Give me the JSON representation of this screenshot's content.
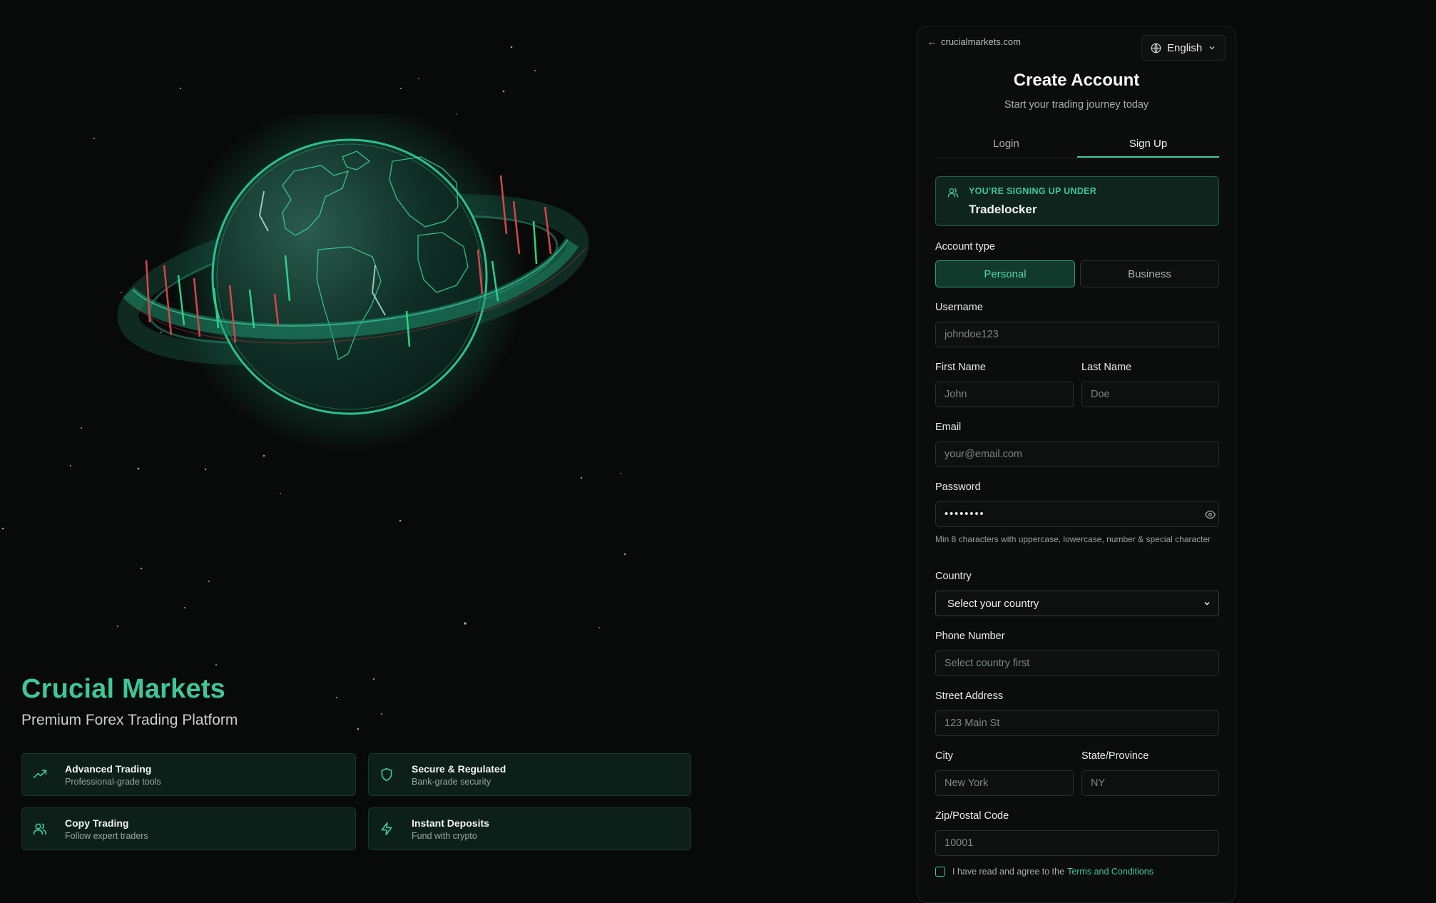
{
  "brand": {
    "title": "Crucial Markets",
    "subtitle": "Premium Forex Trading Platform"
  },
  "features": [
    {
      "icon": "trending-up-icon",
      "title": "Advanced Trading",
      "subtitle": "Professional-grade tools"
    },
    {
      "icon": "shield-icon",
      "title": "Secure & Regulated",
      "subtitle": "Bank-grade security"
    },
    {
      "icon": "users-icon",
      "title": "Copy Trading",
      "subtitle": "Follow expert traders"
    },
    {
      "icon": "lightning-icon",
      "title": "Instant Deposits",
      "subtitle": "Fund with crypto"
    }
  ],
  "header": {
    "back_link": "crucialmarkets.com",
    "language": "English"
  },
  "form": {
    "title": "Create Account",
    "subtitle": "Start your trading journey today",
    "tabs": [
      "Login",
      "Sign Up"
    ],
    "active_tab": "Sign Up",
    "referral_label": "YOU'RE SIGNING UP UNDER",
    "referral_value": "Tradelocker",
    "account_type_label": "Account type",
    "account_types": [
      "Personal",
      "Business"
    ],
    "selected_account_type": "Personal",
    "username_label": "Username",
    "username_placeholder": "johndoe123",
    "first_name_label": "First Name",
    "first_name_placeholder": "John",
    "last_name_label": "Last Name",
    "last_name_placeholder": "Doe",
    "email_label": "Email",
    "email_placeholder": "your@email.com",
    "password_label": "Password",
    "password_value": "••••••••",
    "password_hint": "Min 8 characters with uppercase, lowercase, number & special character",
    "country_label": "Country",
    "country_value": "Select your country",
    "phone_label": "Phone Number",
    "phone_placeholder": "Select country first",
    "street_label": "Street Address",
    "street_placeholder": "123 Main St",
    "city_label": "City",
    "city_placeholder": "New York",
    "state_label": "State/Province",
    "state_placeholder": "NY",
    "zip_label": "Zip/Postal Code",
    "zip_placeholder": "10001",
    "terms_text": "I have read and agree to the",
    "terms_link": "Terms and Conditions"
  },
  "colors": {
    "accent": "#3ec79a",
    "background": "#080909",
    "panel": "#0b0d0c"
  }
}
